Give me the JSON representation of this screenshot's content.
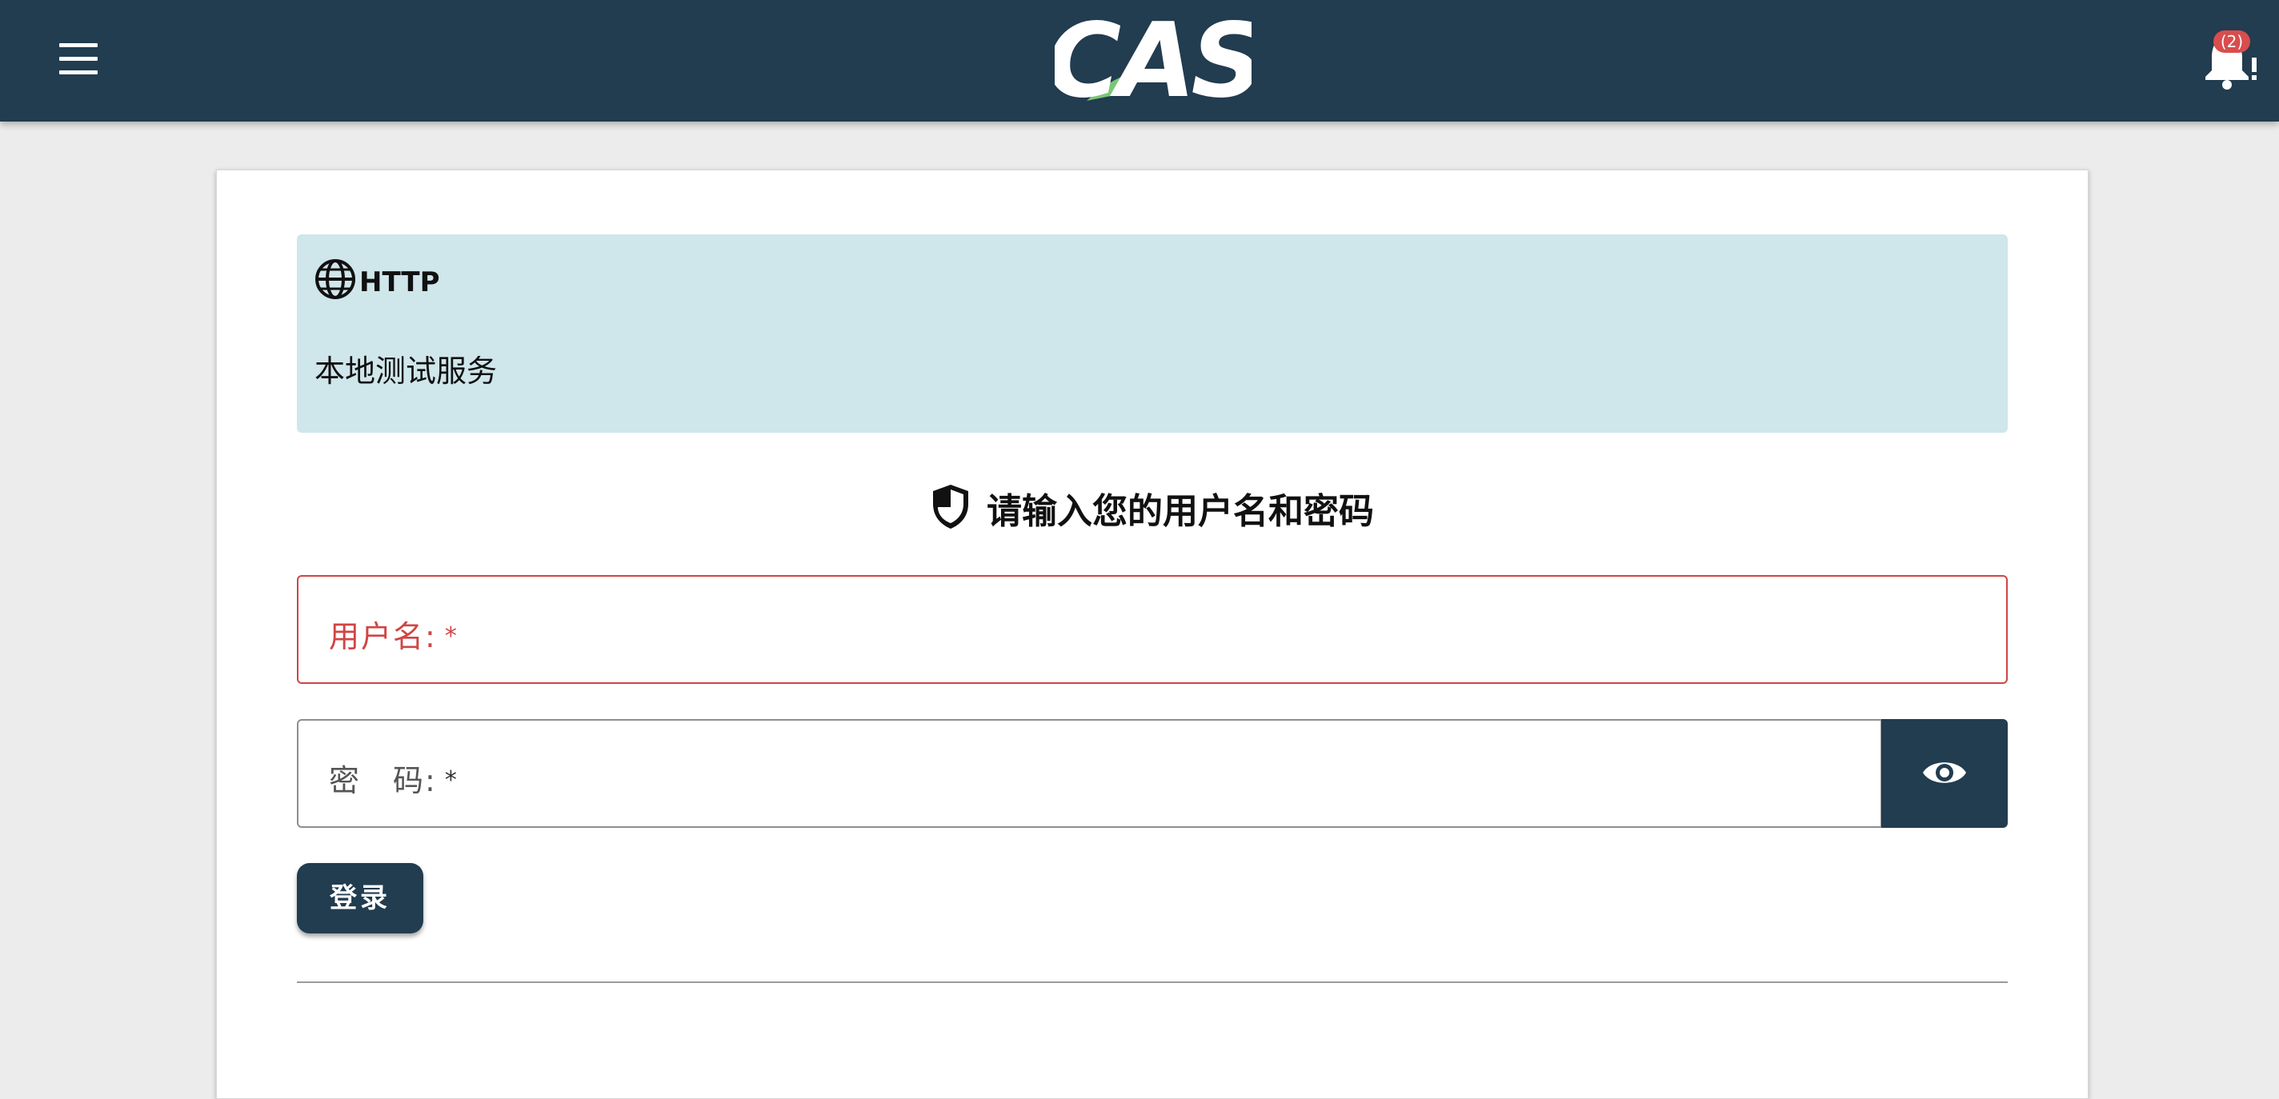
{
  "header": {
    "logo_text": "CAS",
    "menu_icon": "hamburger-menu-icon",
    "notification_icon": "bell-icon",
    "notification_count": "(2)",
    "background_color": "#223c50"
  },
  "service": {
    "icon": "globe-icon",
    "name": "HTTP",
    "description": "本地测试服务",
    "background_color": "#cfe6eb"
  },
  "login": {
    "heading_icon": "shield-icon",
    "heading": "请输入您的用户名和密码",
    "username_label": "用户名:",
    "username_required": "*",
    "password_label": "密　码:",
    "password_required": "*",
    "toggle_password_icon": "eye-icon",
    "submit_label": "登录",
    "error_color": "#d04545",
    "accent_color": "#223c50"
  }
}
